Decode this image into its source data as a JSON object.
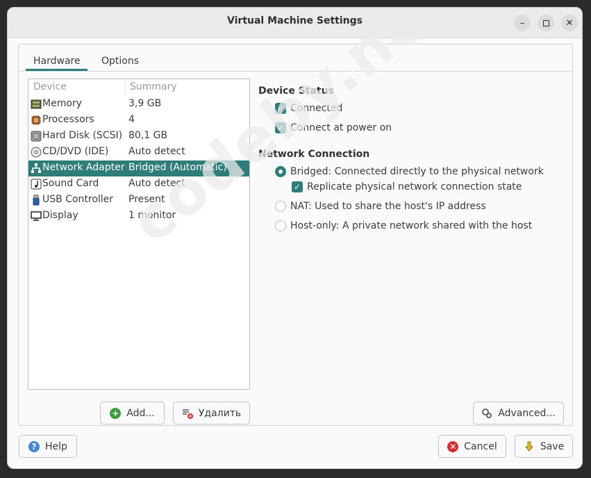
{
  "window": {
    "title": "Virtual Machine Settings"
  },
  "tabs": [
    {
      "label": "Hardware",
      "active": true
    },
    {
      "label": "Options",
      "active": false
    }
  ],
  "device_list": {
    "headers": {
      "device": "Device",
      "summary": "Summary"
    },
    "rows": [
      {
        "icon": "memory-icon",
        "device": "Memory",
        "summary": "3,9 GB",
        "selected": false
      },
      {
        "icon": "processor-icon",
        "device": "Processors",
        "summary": "4",
        "selected": false
      },
      {
        "icon": "hard-disk-icon",
        "device": "Hard Disk (SCSI)",
        "summary": "80,1 GB",
        "selected": false
      },
      {
        "icon": "cd-dvd-icon",
        "device": "CD/DVD (IDE)",
        "summary": "Auto detect",
        "selected": false
      },
      {
        "icon": "network-adapter-icon",
        "device": "Network Adapter",
        "summary": "Bridged (Automatic)",
        "selected": true
      },
      {
        "icon": "sound-card-icon",
        "device": "Sound Card",
        "summary": "Auto detect",
        "selected": false
      },
      {
        "icon": "usb-icon",
        "device": "USB Controller",
        "summary": "Present",
        "selected": false
      },
      {
        "icon": "display-icon",
        "device": "Display",
        "summary": "1 monitor",
        "selected": false
      }
    ]
  },
  "list_buttons": {
    "add": "Add...",
    "remove": "Удалить"
  },
  "device_status": {
    "heading": "Device Status",
    "connected": {
      "label": "Connected",
      "checked": true
    },
    "connect_power_on": {
      "label": "Connect at power on",
      "checked": true
    }
  },
  "network_connection": {
    "heading": "Network Connection",
    "bridged": {
      "label": "Bridged: Connected directly to the physical network",
      "selected": true
    },
    "replicate": {
      "label": "Replicate physical network connection state",
      "checked": true
    },
    "nat": {
      "label": "NAT: Used to share the host's IP address",
      "selected": false
    },
    "host_only": {
      "label": "Host-only: A private network shared with the host",
      "selected": false
    }
  },
  "advanced_button": "Advanced...",
  "footer": {
    "help": "Help",
    "cancel": "Cancel",
    "save": "Save"
  },
  "watermark": "codeby.net",
  "colors": {
    "accent": "#2e7d79",
    "add": "#3f9b3f",
    "cancel": "#d32f2f",
    "help": "#3e86d8",
    "save": "#e3c12d"
  }
}
